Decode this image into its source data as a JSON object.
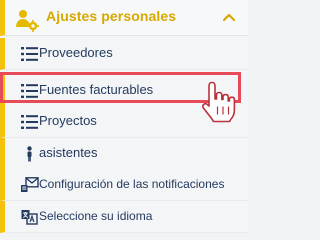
{
  "header": {
    "title": "Ajustes personales",
    "icon": "users-settings-icon",
    "accent": "#f2c20c",
    "title_color": "#d7a800",
    "expanded": true
  },
  "menu": {
    "items": [
      {
        "label": "Proveedores",
        "icon": "list-icon"
      },
      {
        "label": "Fuentes facturables",
        "icon": "list-icon",
        "highlighted": true
      },
      {
        "label": "Proyectos",
        "icon": "list-icon"
      },
      {
        "label": "asistentes",
        "icon": "person-icon"
      },
      {
        "label": "Configuración de las notificaciones",
        "icon": "notification-settings-icon"
      },
      {
        "label": "Seleccione su idioma",
        "icon": "language-icon"
      }
    ]
  },
  "colors": {
    "text": "#243a5e",
    "highlight": "#e74b57",
    "background": "#f4f5f7"
  }
}
